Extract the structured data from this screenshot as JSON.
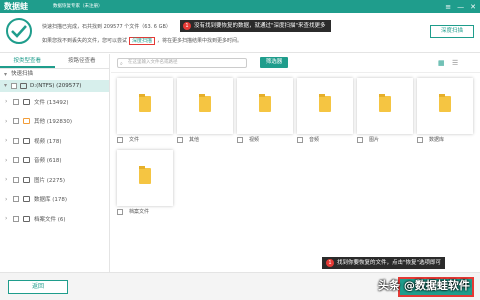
{
  "app": {
    "logo": "数据蛙",
    "subtitle": "数据恢复专家（未注册）",
    "controls": [
      "≡",
      "—",
      "✕"
    ]
  },
  "header": {
    "scan_done": "快速扫描已完成，石共找到 209577 个文件（63. 6 GB）",
    "not_found_prefix": "如果您找不到丢失的文件，您可以尝试",
    "deep_scan_link": "深度扫描",
    "not_found_suffix": "，将在更多扫描结果中找到更多时间。",
    "tip_badge": "1",
    "tip_text": "没有找到要恢复的数据，就通过\"深度扫描\"来查找更多",
    "deep_scan_button": "深度扫描"
  },
  "sidebar": {
    "tabs": [
      {
        "label": "按类型查看"
      },
      {
        "label": "按路径查看"
      }
    ],
    "tree_head": "快速扫描",
    "drive": "D:(NTFS) (209577)",
    "items": [
      {
        "label": "文件 (13492)",
        "icon": "document-icon"
      },
      {
        "label": "其他 (192830)",
        "icon": "other-icon"
      },
      {
        "label": "视频 (178)",
        "icon": "video-icon"
      },
      {
        "label": "音频 (618)",
        "icon": "audio-icon"
      },
      {
        "label": "图片 (2275)",
        "icon": "image-icon"
      },
      {
        "label": "数据库 (178)",
        "icon": "database-icon"
      },
      {
        "label": "档案文件 (6)",
        "icon": "archive-icon"
      }
    ]
  },
  "main": {
    "search_placeholder": "在这里输入文件名或路径",
    "filter_button": "筛选器",
    "folders": [
      {
        "label": "文件"
      },
      {
        "label": "其他"
      },
      {
        "label": "视频"
      },
      {
        "label": "音频"
      },
      {
        "label": "图片"
      },
      {
        "label": "数据库"
      },
      {
        "label": "档案文件"
      }
    ]
  },
  "footer": {
    "back_button": "返回",
    "tip_badge": "1",
    "tip_text": "找到你要恢复的文件，点击\"恢复\"选项即可",
    "watermark": "头条 @数据蛙软件"
  },
  "colors": {
    "accent": "#1f9d8c",
    "highlight": "#e53935",
    "folder": "#f5c542"
  }
}
